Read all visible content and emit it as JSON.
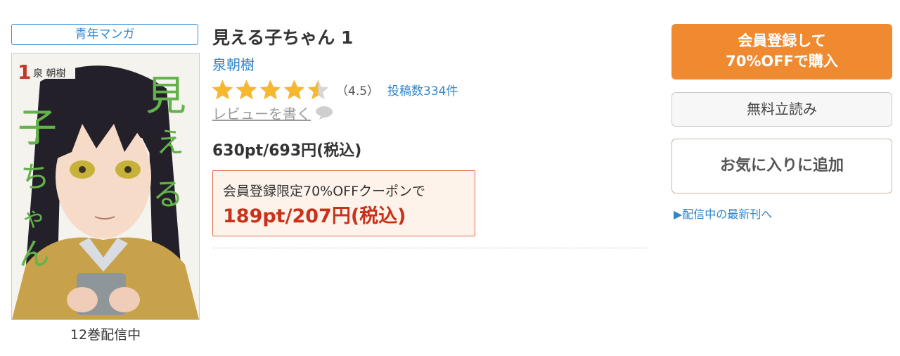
{
  "genre": {
    "label": "青年マンガ"
  },
  "cover": {
    "volume_number": "1",
    "cover_author": "泉 朝樹",
    "cover_title": "見える子ちゃん"
  },
  "volume_count": "12巻配信中",
  "book": {
    "title": "見える子ちゃん 1",
    "author": "泉朝樹",
    "rating": 4.5,
    "rating_text": "（4.5）",
    "review_count": "投稿数334件",
    "write_review": "レビューを書く",
    "price": "630pt/693円(税込)"
  },
  "coupon": {
    "note": "会員登録限定70%OFFクーポンで",
    "price": "189pt/207円(税込)"
  },
  "actions": {
    "buy_line1": "会員登録して",
    "buy_line2": "70%OFFで購入",
    "trial": "無料立読み",
    "favorite": "お気に入りに追加",
    "latest": "▶配信中の最新刊へ"
  },
  "colors": {
    "accent_orange": "#f08a31",
    "link_blue": "#2f86cb",
    "star_gold": "#f5b82e",
    "coupon_red": "#c9311b"
  }
}
